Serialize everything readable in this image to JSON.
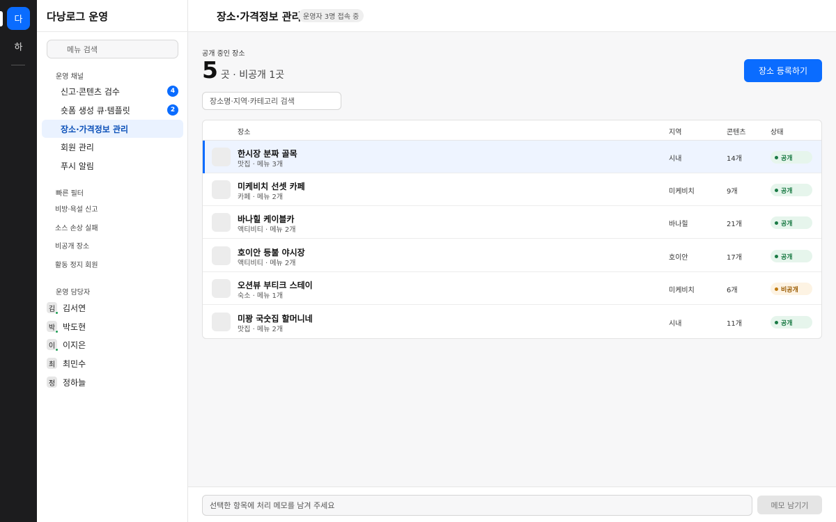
{
  "rail": {
    "workspaces": [
      {
        "initial": "다",
        "active": true
      },
      {
        "initial": "하",
        "active": false
      }
    ]
  },
  "sidebar": {
    "title": "다낭로그 운영",
    "search_placeholder": "메뉴 검색",
    "sections": {
      "channels": "운영 채널",
      "filters": "빠른 필터",
      "staff": "운영 담당자"
    },
    "nav": [
      {
        "label": "신고·콘텐츠 검수",
        "badge": "4"
      },
      {
        "label": "숏폼 생성 큐·템플릿",
        "badge": "2"
      },
      {
        "label": "장소·가격정보 관리",
        "active": true
      },
      {
        "label": "회원 관리"
      },
      {
        "label": "푸시 알림"
      }
    ],
    "filters": [
      "비방·욕설 신고",
      "소스 손상 실패",
      "비공개 장소",
      "활동 정지 회원"
    ],
    "staff": [
      {
        "initial": "김",
        "name": "김서연",
        "online": true
      },
      {
        "initial": "박",
        "name": "박도현",
        "online": true
      },
      {
        "initial": "이",
        "name": "이지은",
        "online": true
      },
      {
        "initial": "최",
        "name": "최민수",
        "online": false
      },
      {
        "initial": "정",
        "name": "정하늘",
        "online": false
      }
    ]
  },
  "header": {
    "title": "장소·가격정보 관리",
    "presence": "운영자 3명 접속 중"
  },
  "summary": {
    "label": "공개 중인 장소",
    "count": "5",
    "rest": "곳 · 비공개 1곳"
  },
  "actions": {
    "register": "장소 등록하기",
    "search_placeholder": "장소명·지역·카테고리 검색"
  },
  "table": {
    "columns": {
      "place": "장소",
      "region": "지역",
      "content": "콘텐츠",
      "status": "상태"
    },
    "rows": [
      {
        "name": "한시장 분짜 골목",
        "meta": "맛집 · 메뉴 3개",
        "region": "시내",
        "content": "14개",
        "status": "공개",
        "status_type": "public",
        "selected": true
      },
      {
        "name": "미케비치 선셋 카페",
        "meta": "카페 · 메뉴 2개",
        "region": "미케비치",
        "content": "9개",
        "status": "공개",
        "status_type": "public"
      },
      {
        "name": "바나힐 케이블카",
        "meta": "액티비티 · 메뉴 2개",
        "region": "바나힐",
        "content": "21개",
        "status": "공개",
        "status_type": "public"
      },
      {
        "name": "호이안 등불 야시장",
        "meta": "액티비티 · 메뉴 2개",
        "region": "호이안",
        "content": "17개",
        "status": "공개",
        "status_type": "public"
      },
      {
        "name": "오션뷰 부티크 스테이",
        "meta": "숙소 · 메뉴 1개",
        "region": "미케비치",
        "content": "6개",
        "status": "비공개",
        "status_type": "private"
      },
      {
        "name": "미꽝 국숫집 할머니네",
        "meta": "맛집 · 메뉴 2개",
        "region": "시내",
        "content": "11개",
        "status": "공개",
        "status_type": "public"
      }
    ]
  },
  "memo": {
    "placeholder": "선택한 항목에 처리 메모를 남겨 주세요",
    "button": "메모 남기기"
  },
  "colors": {
    "accent": "#0a6cff",
    "rail": "#1c1c1e",
    "public": "#1a7a44",
    "private": "#9a5a00"
  }
}
